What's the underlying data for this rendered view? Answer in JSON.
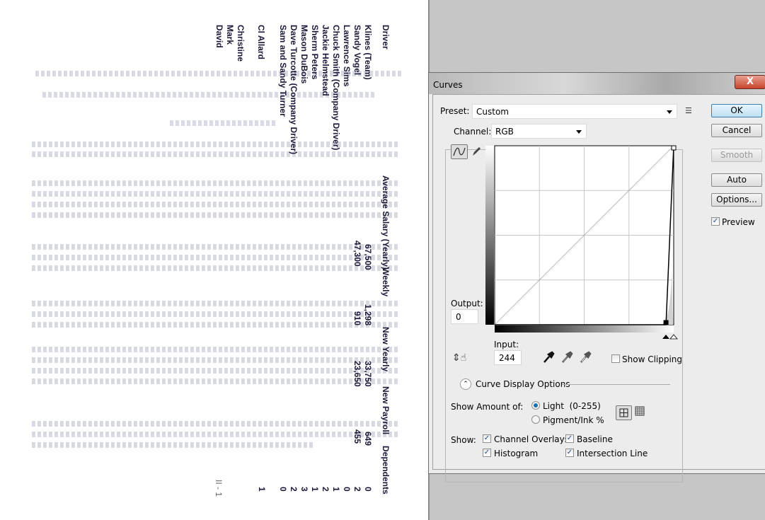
{
  "document": {
    "headers": [
      "Driver",
      "Average Salary (Yearly)",
      "Weekly",
      "New Yearly",
      "New Payroll",
      "Dependents"
    ],
    "drivers": [
      "Klines (Team)",
      "Sandy Vogel",
      "Lawrence Sims",
      "Chuck Smith (Company Driver)",
      "Jackie Helmstead",
      "Sherm Peters",
      "Mason DuBois",
      "Dave Turcotte (Company Driver)",
      "Sam and Sandy Turner",
      "Cl Allard",
      "Christine",
      "Mark",
      "David"
    ],
    "rows": [
      {
        "salary": "67,500",
        "weekly": "1,298",
        "new_yearly": "33,750",
        "new_payroll": "649"
      },
      {
        "salary": "47,300",
        "weekly": "910",
        "new_yearly": "23,650",
        "new_payroll": "455"
      }
    ],
    "dependents": [
      "0",
      "2",
      "0",
      "1",
      "2",
      "1",
      "3",
      "2",
      "0",
      "1"
    ],
    "footer": "II - 1"
  },
  "dialog": {
    "title": "Curves",
    "close_label": "X",
    "preset_label": "Preset:",
    "preset_value": "Custom",
    "channel_label": "Channel:",
    "channel_value": "RGB",
    "buttons": {
      "ok": "OK",
      "cancel": "Cancel",
      "smooth": "Smooth",
      "auto": "Auto",
      "options": "Options..."
    },
    "preview_label": "Preview",
    "preview_checked": true,
    "output_label": "Output:",
    "output_value": "0",
    "input_label": "Input:",
    "input_value": "244",
    "show_clipping_label": "Show Clipping",
    "curve_display_options": "Curve Display Options",
    "show_amount_label": "Show Amount of:",
    "amount_options": [
      "Light  (0-255)",
      "Pigment/Ink %"
    ],
    "amount_selected": "Light  (0-255)",
    "show_label": "Show:",
    "show_options": {
      "channel_overlays": "Channel Overlays",
      "baseline": "Baseline",
      "histogram": "Histogram",
      "intersection_line": "Intersection Line"
    },
    "curve_points": [
      [
        0,
        0
      ],
      [
        244,
        0
      ],
      [
        255,
        255
      ]
    ],
    "accent_color": "#3c7fb1"
  }
}
